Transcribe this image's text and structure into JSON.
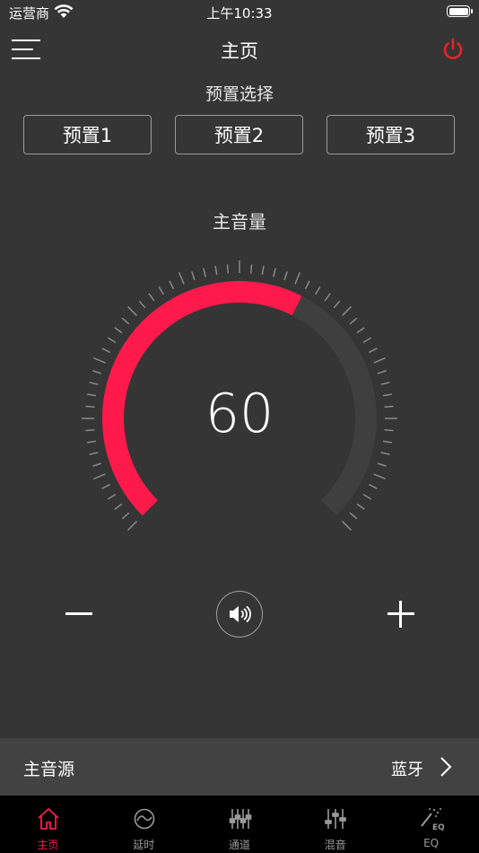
{
  "status_bar": {
    "carrier": "运营商",
    "time": "上午10:33"
  },
  "header": {
    "title": "主页"
  },
  "presets": {
    "heading": "预置选择",
    "items": [
      {
        "label": "预置1"
      },
      {
        "label": "预置2"
      },
      {
        "label": "预置3"
      }
    ]
  },
  "volume": {
    "heading": "主音量",
    "value": "60",
    "level_fraction": 0.6
  },
  "source": {
    "label": "主音源",
    "value": "蓝牙"
  },
  "tabs": [
    {
      "label": "主页",
      "icon": "home-icon",
      "active": true
    },
    {
      "label": "延时",
      "icon": "delay-icon",
      "active": false
    },
    {
      "label": "通道",
      "icon": "channel-sliders-icon",
      "active": false
    },
    {
      "label": "混音",
      "icon": "mixer-sliders-icon",
      "active": false
    },
    {
      "label": "EQ",
      "icon": "eq-wand-icon",
      "active": false
    }
  ],
  "colors": {
    "background": "#353535",
    "accent": "#ff1a4b",
    "power": "#e8222c",
    "track": "#3f3f3f",
    "tabbar": "#000000",
    "source_bar": "#424242"
  }
}
